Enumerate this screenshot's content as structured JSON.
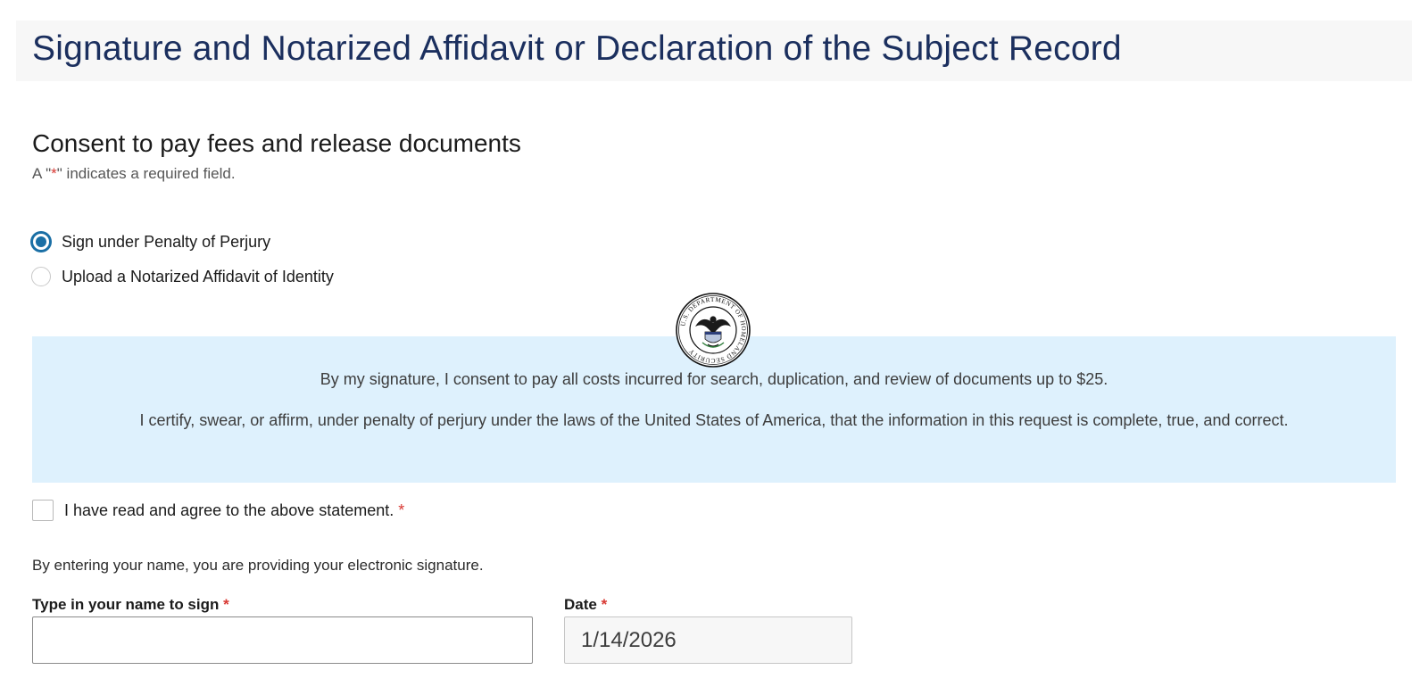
{
  "header": {
    "title": "Signature and Notarized Affidavit or Declaration of the Subject Record"
  },
  "section": {
    "title": "Consent to pay fees and release documents",
    "required_note_prefix": "A \"",
    "required_note_star": "*",
    "required_note_suffix": "\" indicates a required field."
  },
  "signature_method": {
    "options": [
      {
        "label": "Sign under Penalty of Perjury",
        "selected": true
      },
      {
        "label": "Upload a Notarized Affidavit of Identity",
        "selected": false
      }
    ]
  },
  "seal": {
    "icon": "dhs-seal-icon",
    "text": "U.S. DEPARTMENT OF HOMELAND SECURITY"
  },
  "statement": {
    "line1": "By my signature, I consent to pay all costs incurred for search, duplication, and review of documents up to $25.",
    "line2": "I certify, swear, or affirm, under penalty of perjury under the laws of the United States of America, that the information in this request is complete, true, and correct."
  },
  "agreement": {
    "label": "I have read and agree to the above statement.",
    "required_star": "*",
    "checked": false
  },
  "esign": {
    "note": "By entering your name, you are providing your electronic signature."
  },
  "fields": {
    "name": {
      "label": "Type in your name to sign",
      "required_star": "*",
      "value": ""
    },
    "date": {
      "label": "Date",
      "required_star": "*",
      "value": "1/14/2026"
    }
  },
  "colors": {
    "title": "#1b2f5e",
    "accent": "#1a6fa5",
    "statement_bg": "#def1fd",
    "required": "#d83933"
  }
}
